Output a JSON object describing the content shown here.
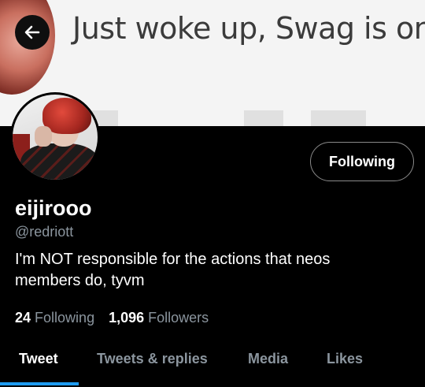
{
  "banner": {
    "text": "Just woke up, Swag is on"
  },
  "profile": {
    "display_name": "eijirooo",
    "handle": "@redriott",
    "bio": "I'm NOT responsible for the actions that neos members do, tyvm",
    "follow_button_label": "Following"
  },
  "stats": {
    "following_count": "24",
    "following_label": "Following",
    "followers_count": "1,096",
    "followers_label": "Followers"
  },
  "tabs": [
    {
      "label": "Tweet",
      "active": true
    },
    {
      "label": "Tweets & replies",
      "active": false
    },
    {
      "label": "Media",
      "active": false
    },
    {
      "label": "Likes",
      "active": false
    }
  ],
  "colors": {
    "accent": "#1d9bf0",
    "background": "#000000",
    "muted_text": "#8b959e"
  },
  "icons": {
    "back": "arrow-left-icon"
  }
}
